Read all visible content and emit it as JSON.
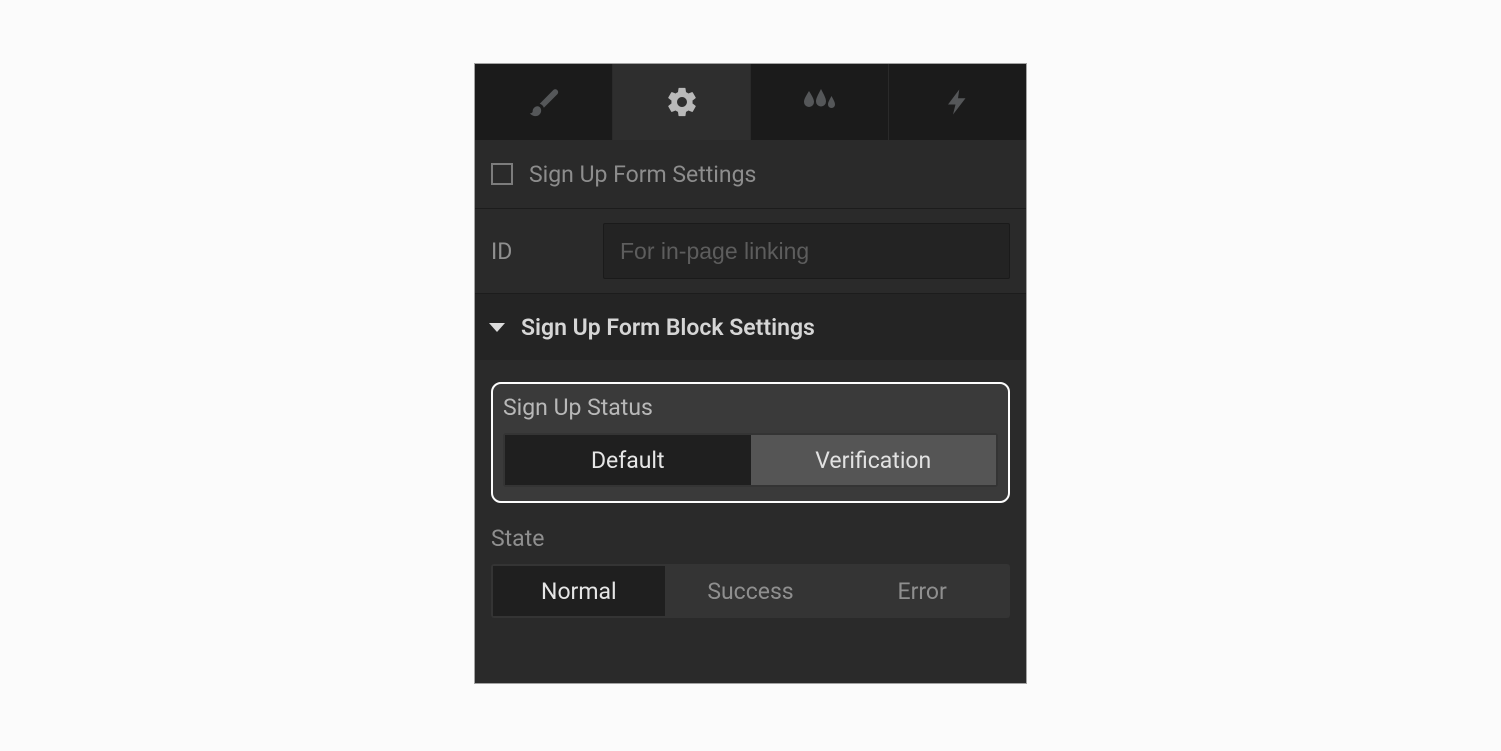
{
  "tabs": {
    "items": [
      {
        "name": "brush-icon",
        "active": false
      },
      {
        "name": "gear-icon",
        "active": true
      },
      {
        "name": "drops-icon",
        "active": false
      },
      {
        "name": "bolt-icon",
        "active": false
      }
    ]
  },
  "checkbox_row": {
    "label": "Sign Up Form Settings",
    "checked": false
  },
  "id_row": {
    "label": "ID",
    "placeholder": "For in-page linking",
    "value": ""
  },
  "collapse": {
    "title": "Sign Up Form Block Settings",
    "expanded": true
  },
  "signup_status": {
    "label": "Sign Up Status",
    "options": [
      "Default",
      "Verification"
    ],
    "selected": "Default"
  },
  "state": {
    "label": "State",
    "options": [
      "Normal",
      "Success",
      "Error"
    ],
    "selected": "Normal"
  }
}
